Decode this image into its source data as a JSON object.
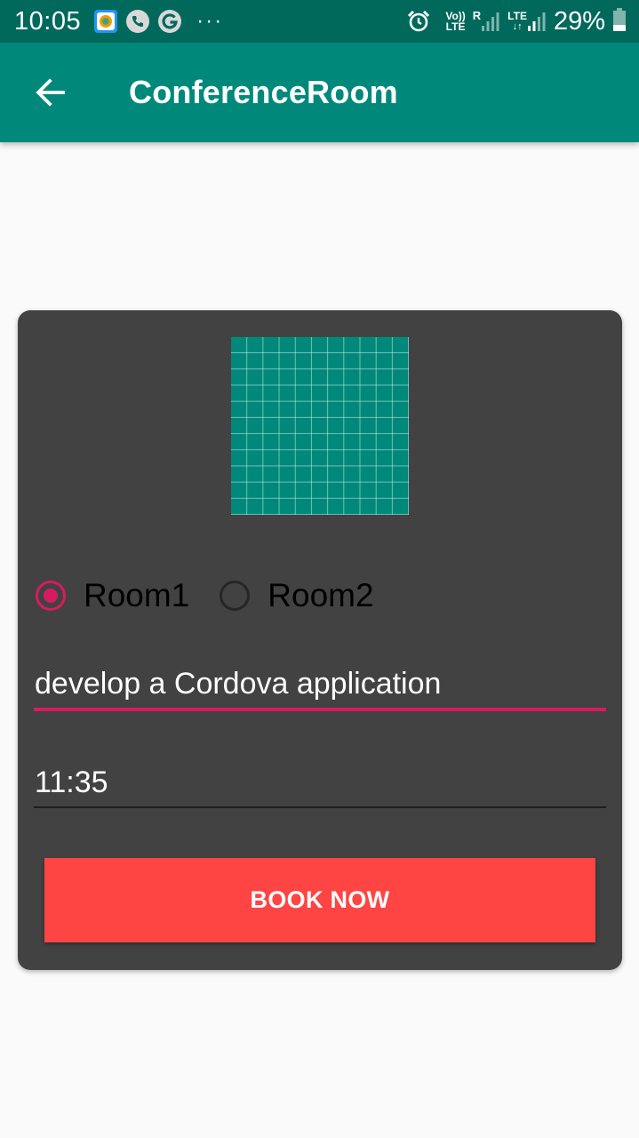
{
  "status_bar": {
    "time": "10:05",
    "dots": "···",
    "volte_top": "Vo))",
    "volte_bottom": "LTE",
    "roaming": "R",
    "lte": "LTE",
    "battery": "29%"
  },
  "app_bar": {
    "title": "ConferenceRoom"
  },
  "form": {
    "rooms": [
      {
        "label": "Room1",
        "checked": true
      },
      {
        "label": "Room2",
        "checked": false
      }
    ],
    "task": "develop a Cordova application",
    "time": "11:35",
    "book_button": "BOOK NOW"
  },
  "colors": {
    "status_bar": "#00695c",
    "app_bar": "#00897b",
    "card": "#424242",
    "accent": "#d81b60",
    "button": "#ff4444"
  }
}
